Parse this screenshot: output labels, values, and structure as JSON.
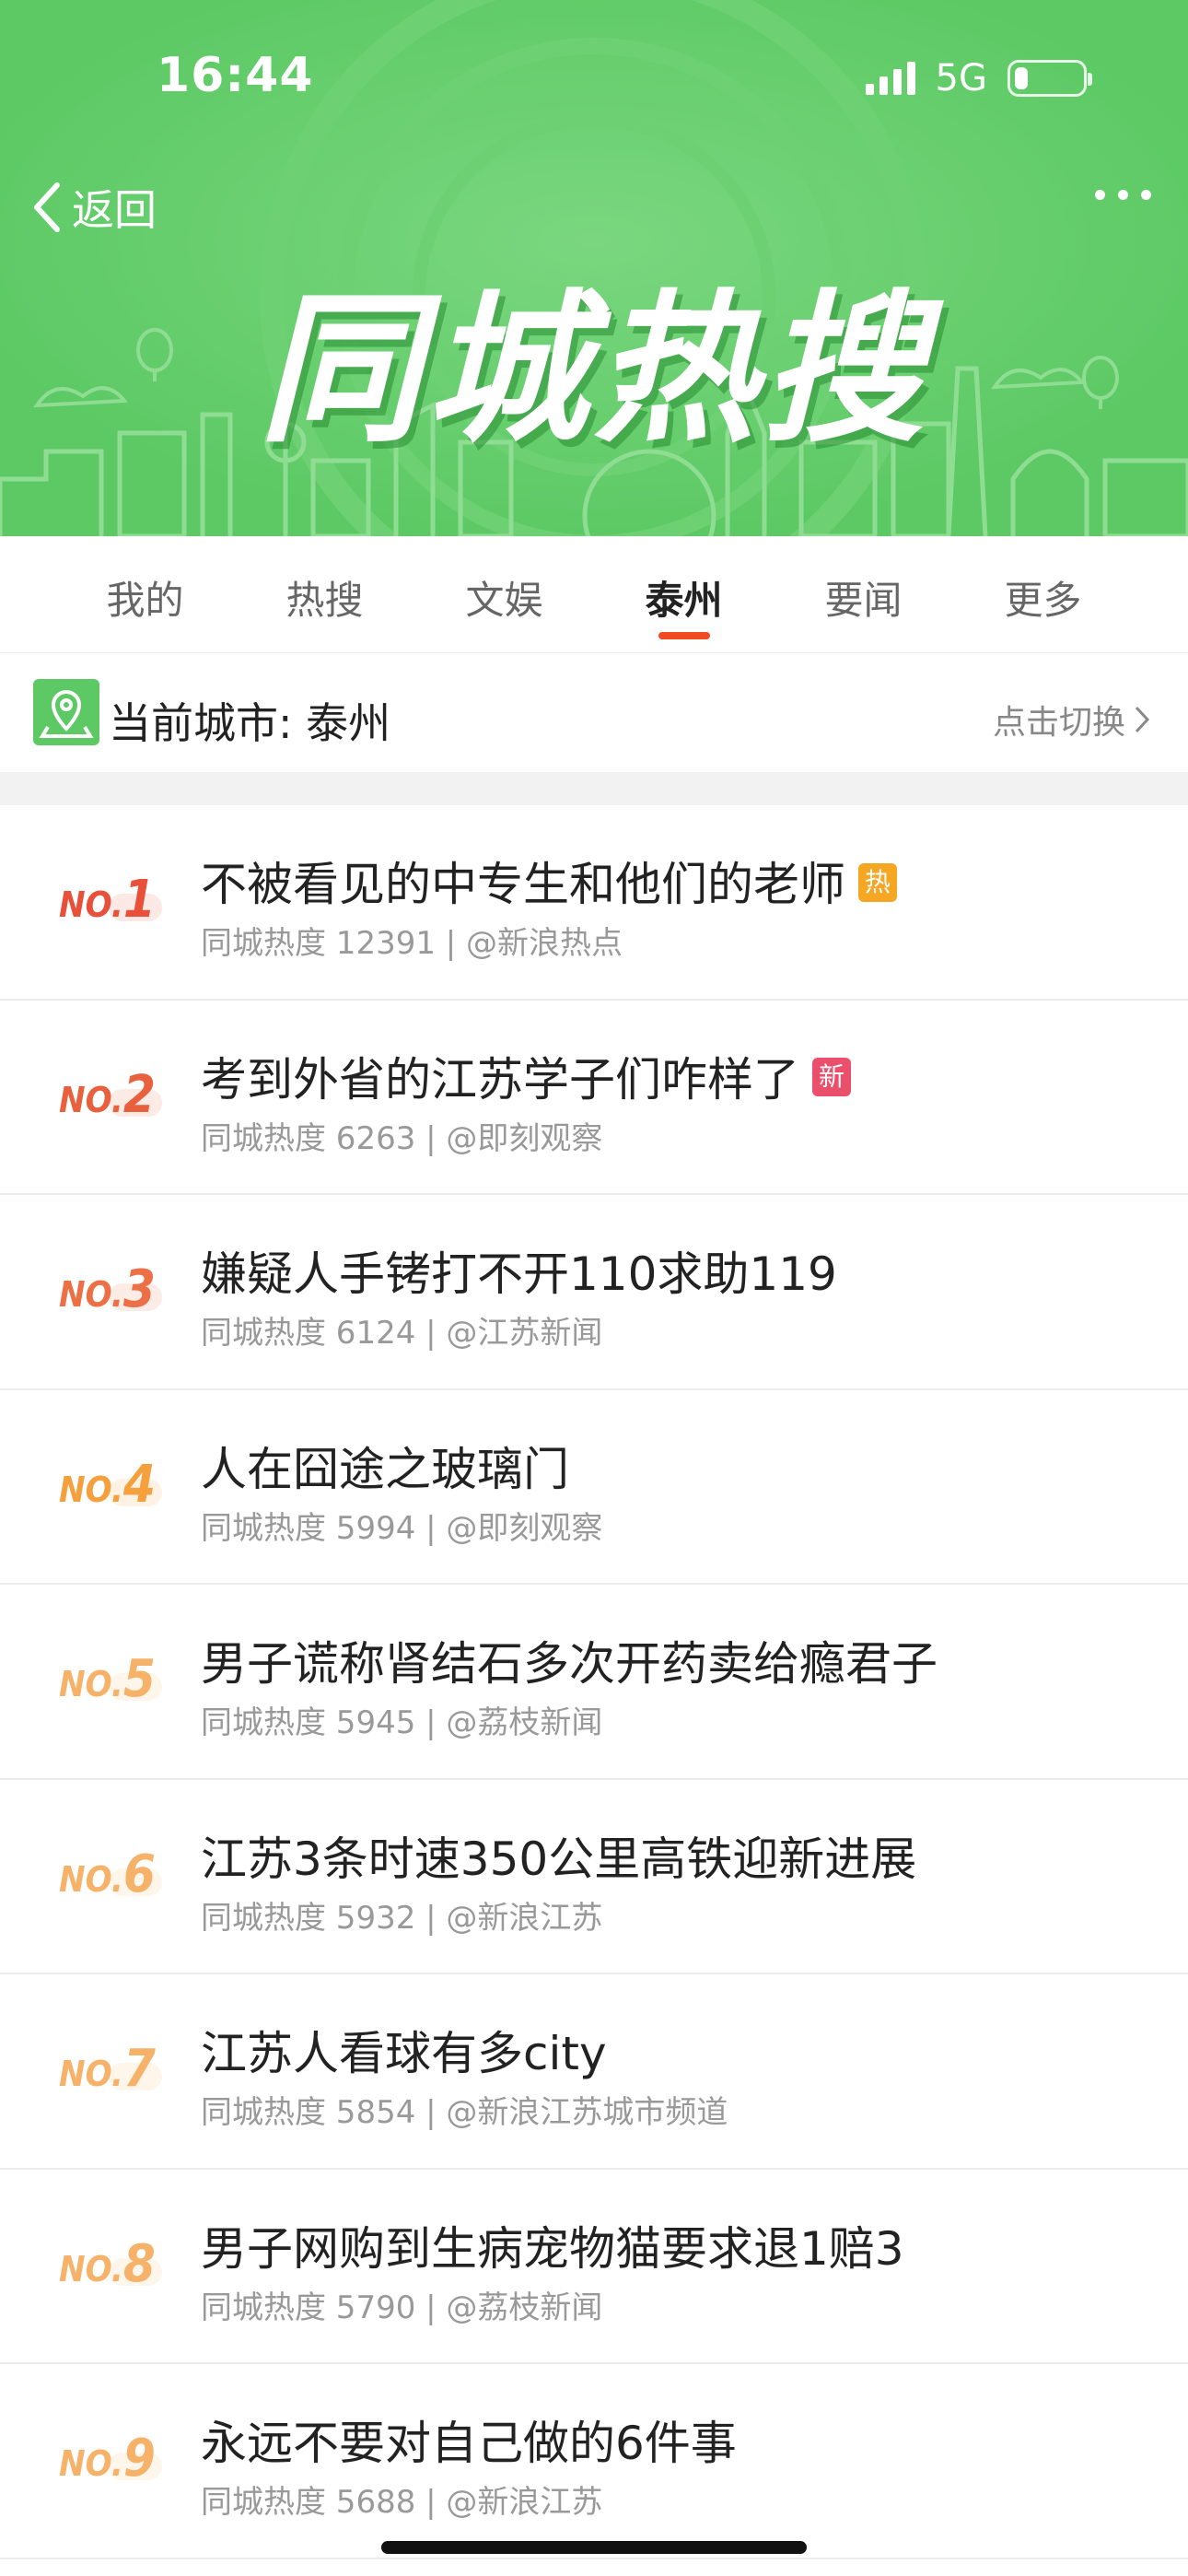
{
  "status_bar": {
    "time": "16:44",
    "network": "5G",
    "battery_level": 0.2
  },
  "header": {
    "back_label": "返回",
    "banner_title": "同城热搜",
    "colors": {
      "background": "#5cc964",
      "accent": "#f04b22"
    }
  },
  "tabs": [
    {
      "label": "我的",
      "active": false
    },
    {
      "label": "热搜",
      "active": false
    },
    {
      "label": "文娱",
      "active": false
    },
    {
      "label": "泰州",
      "active": true
    },
    {
      "label": "要闻",
      "active": false
    },
    {
      "label": "更多",
      "active": false
    }
  ],
  "city": {
    "label": "当前城市: 泰州",
    "switch_label": "点击切换"
  },
  "list": [
    {
      "no": "NO.",
      "num": "1",
      "title": "不被看见的中专生和他们的老师",
      "badge": "热",
      "badge_color": "#f5a623",
      "meta": "同城热度 12391 | @新浪热点",
      "rank_color": "#e8503a"
    },
    {
      "no": "NO.",
      "num": "2",
      "title": "考到外省的江苏学子们咋样了",
      "badge": "新",
      "badge_color": "#ea4f6c",
      "meta": "同城热度 6263 | @即刻观察",
      "rank_color": "#e8603e"
    },
    {
      "no": "NO.",
      "num": "3",
      "title": "嫌疑人手铐打不开110求助119",
      "badge": "",
      "badge_color": "",
      "meta": "同城热度 6124 | @江苏新闻",
      "rank_color": "#ec6f46"
    },
    {
      "no": "NO.",
      "num": "4",
      "title": "人在囧途之玻璃门",
      "badge": "",
      "badge_color": "",
      "meta": "同城热度 5994 | @即刻观察",
      "rank_color": "#f5a03c"
    },
    {
      "no": "NO.",
      "num": "5",
      "title": "男子谎称肾结石多次开药卖给瘾君子",
      "badge": "",
      "badge_color": "",
      "meta": "同城热度 5945 | @荔枝新闻",
      "rank_color": "#f7b26a"
    },
    {
      "no": "NO.",
      "num": "6",
      "title": "江苏3条时速350公里高铁迎新进展",
      "badge": "",
      "badge_color": "",
      "meta": "同城热度 5932 | @新浪江苏",
      "rank_color": "#f7b26a"
    },
    {
      "no": "NO.",
      "num": "7",
      "title": "江苏人看球有多city",
      "badge": "",
      "badge_color": "",
      "meta": "同城热度 5854 | @新浪江苏城市频道",
      "rank_color": "#f7b26a"
    },
    {
      "no": "NO.",
      "num": "8",
      "title": "男子网购到生病宠物猫要求退1赔3",
      "badge": "",
      "badge_color": "",
      "meta": "同城热度 5790 | @荔枝新闻",
      "rank_color": "#f7b26a"
    },
    {
      "no": "NO.",
      "num": "9",
      "title": "永远不要对自己做的6件事",
      "badge": "",
      "badge_color": "",
      "meta": "同城热度 5688 | @新浪江苏",
      "rank_color": "#f7b26a"
    }
  ]
}
